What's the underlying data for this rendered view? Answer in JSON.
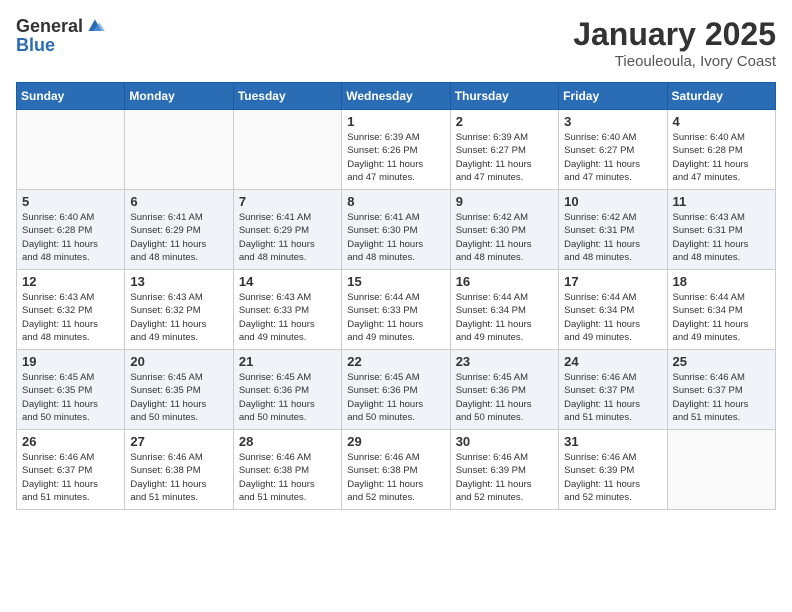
{
  "header": {
    "logo_general": "General",
    "logo_blue": "Blue",
    "month": "January 2025",
    "location": "Tieouleoula, Ivory Coast"
  },
  "days_of_week": [
    "Sunday",
    "Monday",
    "Tuesday",
    "Wednesday",
    "Thursday",
    "Friday",
    "Saturday"
  ],
  "weeks": [
    [
      {
        "day": "",
        "info": ""
      },
      {
        "day": "",
        "info": ""
      },
      {
        "day": "",
        "info": ""
      },
      {
        "day": "1",
        "info": "Sunrise: 6:39 AM\nSunset: 6:26 PM\nDaylight: 11 hours\nand 47 minutes."
      },
      {
        "day": "2",
        "info": "Sunrise: 6:39 AM\nSunset: 6:27 PM\nDaylight: 11 hours\nand 47 minutes."
      },
      {
        "day": "3",
        "info": "Sunrise: 6:40 AM\nSunset: 6:27 PM\nDaylight: 11 hours\nand 47 minutes."
      },
      {
        "day": "4",
        "info": "Sunrise: 6:40 AM\nSunset: 6:28 PM\nDaylight: 11 hours\nand 47 minutes."
      }
    ],
    [
      {
        "day": "5",
        "info": "Sunrise: 6:40 AM\nSunset: 6:28 PM\nDaylight: 11 hours\nand 48 minutes."
      },
      {
        "day": "6",
        "info": "Sunrise: 6:41 AM\nSunset: 6:29 PM\nDaylight: 11 hours\nand 48 minutes."
      },
      {
        "day": "7",
        "info": "Sunrise: 6:41 AM\nSunset: 6:29 PM\nDaylight: 11 hours\nand 48 minutes."
      },
      {
        "day": "8",
        "info": "Sunrise: 6:41 AM\nSunset: 6:30 PM\nDaylight: 11 hours\nand 48 minutes."
      },
      {
        "day": "9",
        "info": "Sunrise: 6:42 AM\nSunset: 6:30 PM\nDaylight: 11 hours\nand 48 minutes."
      },
      {
        "day": "10",
        "info": "Sunrise: 6:42 AM\nSunset: 6:31 PM\nDaylight: 11 hours\nand 48 minutes."
      },
      {
        "day": "11",
        "info": "Sunrise: 6:43 AM\nSunset: 6:31 PM\nDaylight: 11 hours\nand 48 minutes."
      }
    ],
    [
      {
        "day": "12",
        "info": "Sunrise: 6:43 AM\nSunset: 6:32 PM\nDaylight: 11 hours\nand 48 minutes."
      },
      {
        "day": "13",
        "info": "Sunrise: 6:43 AM\nSunset: 6:32 PM\nDaylight: 11 hours\nand 49 minutes."
      },
      {
        "day": "14",
        "info": "Sunrise: 6:43 AM\nSunset: 6:33 PM\nDaylight: 11 hours\nand 49 minutes."
      },
      {
        "day": "15",
        "info": "Sunrise: 6:44 AM\nSunset: 6:33 PM\nDaylight: 11 hours\nand 49 minutes."
      },
      {
        "day": "16",
        "info": "Sunrise: 6:44 AM\nSunset: 6:34 PM\nDaylight: 11 hours\nand 49 minutes."
      },
      {
        "day": "17",
        "info": "Sunrise: 6:44 AM\nSunset: 6:34 PM\nDaylight: 11 hours\nand 49 minutes."
      },
      {
        "day": "18",
        "info": "Sunrise: 6:44 AM\nSunset: 6:34 PM\nDaylight: 11 hours\nand 49 minutes."
      }
    ],
    [
      {
        "day": "19",
        "info": "Sunrise: 6:45 AM\nSunset: 6:35 PM\nDaylight: 11 hours\nand 50 minutes."
      },
      {
        "day": "20",
        "info": "Sunrise: 6:45 AM\nSunset: 6:35 PM\nDaylight: 11 hours\nand 50 minutes."
      },
      {
        "day": "21",
        "info": "Sunrise: 6:45 AM\nSunset: 6:36 PM\nDaylight: 11 hours\nand 50 minutes."
      },
      {
        "day": "22",
        "info": "Sunrise: 6:45 AM\nSunset: 6:36 PM\nDaylight: 11 hours\nand 50 minutes."
      },
      {
        "day": "23",
        "info": "Sunrise: 6:45 AM\nSunset: 6:36 PM\nDaylight: 11 hours\nand 50 minutes."
      },
      {
        "day": "24",
        "info": "Sunrise: 6:46 AM\nSunset: 6:37 PM\nDaylight: 11 hours\nand 51 minutes."
      },
      {
        "day": "25",
        "info": "Sunrise: 6:46 AM\nSunset: 6:37 PM\nDaylight: 11 hours\nand 51 minutes."
      }
    ],
    [
      {
        "day": "26",
        "info": "Sunrise: 6:46 AM\nSunset: 6:37 PM\nDaylight: 11 hours\nand 51 minutes."
      },
      {
        "day": "27",
        "info": "Sunrise: 6:46 AM\nSunset: 6:38 PM\nDaylight: 11 hours\nand 51 minutes."
      },
      {
        "day": "28",
        "info": "Sunrise: 6:46 AM\nSunset: 6:38 PM\nDaylight: 11 hours\nand 51 minutes."
      },
      {
        "day": "29",
        "info": "Sunrise: 6:46 AM\nSunset: 6:38 PM\nDaylight: 11 hours\nand 52 minutes."
      },
      {
        "day": "30",
        "info": "Sunrise: 6:46 AM\nSunset: 6:39 PM\nDaylight: 11 hours\nand 52 minutes."
      },
      {
        "day": "31",
        "info": "Sunrise: 6:46 AM\nSunset: 6:39 PM\nDaylight: 11 hours\nand 52 minutes."
      },
      {
        "day": "",
        "info": ""
      }
    ]
  ]
}
